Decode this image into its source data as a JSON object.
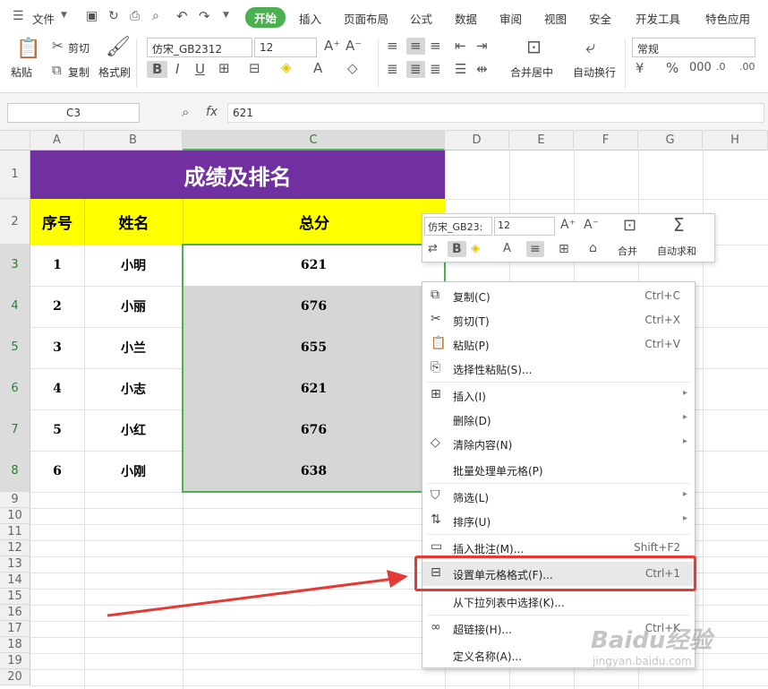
{
  "menubar": {
    "file": "文件",
    "tabs": [
      "开始",
      "插入",
      "页面布局",
      "公式",
      "数据",
      "审阅",
      "视图",
      "安全",
      "开发工具",
      "特色应用"
    ]
  },
  "ribbon": {
    "paste": "粘贴",
    "cut": "剪切",
    "copy": "复制",
    "format_painter": "格式刷",
    "font": "仿宋_GB2312",
    "size": "12",
    "merge": "合并居中",
    "wrap": "自动换行",
    "number_format": "常规"
  },
  "formula": {
    "cell_ref": "C3",
    "fx": "fx",
    "value": "621"
  },
  "columns": [
    "A",
    "B",
    "C",
    "D",
    "E",
    "F",
    "G",
    "H"
  ],
  "rows": [
    "1",
    "2",
    "3",
    "4",
    "5",
    "6",
    "7",
    "8",
    "9",
    "10",
    "11",
    "12",
    "13",
    "14",
    "15",
    "16",
    "17",
    "18",
    "19",
    "20"
  ],
  "table": {
    "title": "成绩及排名",
    "headers": [
      "序号",
      "姓名",
      "总分"
    ],
    "rows": [
      [
        "1",
        "小明",
        "621"
      ],
      [
        "2",
        "小丽",
        "676"
      ],
      [
        "3",
        "小兰",
        "655"
      ],
      [
        "4",
        "小志",
        "621"
      ],
      [
        "5",
        "小红",
        "676"
      ],
      [
        "6",
        "小刚",
        "638"
      ]
    ]
  },
  "minitoolbar": {
    "font": "仿宋_GB23:",
    "size": "12",
    "merge": "合并",
    "autosum": "自动求和"
  },
  "context_menu": [
    {
      "label": "复制(C)",
      "shortcut": "Ctrl+C"
    },
    {
      "label": "剪切(T)",
      "shortcut": "Ctrl+X"
    },
    {
      "label": "粘贴(P)",
      "shortcut": "Ctrl+V"
    },
    {
      "label": "选择性粘贴(S)...",
      "shortcut": ""
    },
    {
      "label": "插入(I)",
      "shortcut": ""
    },
    {
      "label": "删除(D)",
      "shortcut": ""
    },
    {
      "label": "清除内容(N)",
      "shortcut": ""
    },
    {
      "label": "批量处理单元格(P)",
      "shortcut": ""
    },
    {
      "label": "筛选(L)",
      "shortcut": ""
    },
    {
      "label": "排序(U)",
      "shortcut": ""
    },
    {
      "label": "插入批注(M)...",
      "shortcut": "Shift+F2"
    },
    {
      "label": "设置单元格格式(F)...",
      "shortcut": "Ctrl+1"
    },
    {
      "label": "从下拉列表中选择(K)...",
      "shortcut": ""
    },
    {
      "label": "超链接(H)...",
      "shortcut": "Ctrl+K"
    },
    {
      "label": "定义名称(A)...",
      "shortcut": ""
    }
  ],
  "watermark": {
    "text": "Baidu经验",
    "url": "jingyan.baidu.com"
  },
  "colors": {
    "title_bg": "#7030a0",
    "header_bg": "#ffff00",
    "active_tab": "#4caf50",
    "highlight": "#e53935",
    "selection_border": "#4caf50"
  }
}
